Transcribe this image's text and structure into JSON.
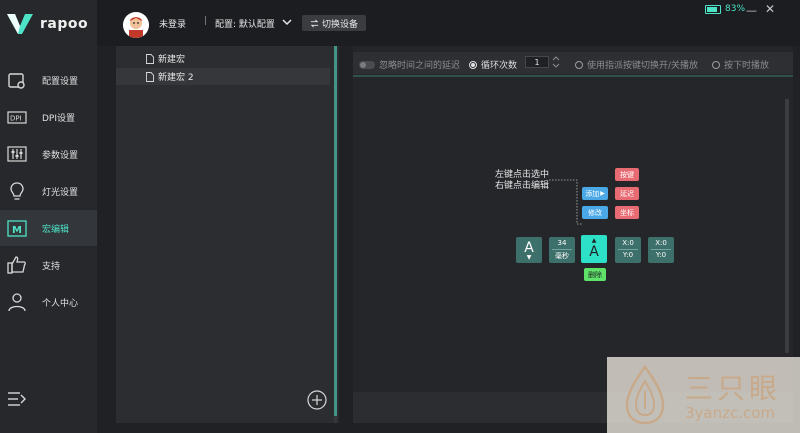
{
  "app": {
    "brand": "rapoo",
    "accent_color": "#4de3c6"
  },
  "sidebar": {
    "items": [
      {
        "label": "配置设置",
        "icon": "mouse-config-icon"
      },
      {
        "label": "DPI设置",
        "icon": "dpi-icon"
      },
      {
        "label": "参数设置",
        "icon": "sliders-icon"
      },
      {
        "label": "灯光设置",
        "icon": "lightbulb-icon"
      },
      {
        "label": "宏编辑",
        "icon": "macro-icon",
        "active": true
      },
      {
        "label": "支持",
        "icon": "thumbs-up-icon"
      },
      {
        "label": "个人中心",
        "icon": "user-icon"
      }
    ],
    "bottom_icon": "collapse-menu-icon"
  },
  "header": {
    "login_status": "未登录",
    "separator": "|",
    "config_label": "配置: 默认配置",
    "switch_device_label": "切换设备",
    "battery_percent": "83%",
    "battery_level": 0.83,
    "minimize_glyph": "—",
    "close_glyph": "✕"
  },
  "macro_list": {
    "items": [
      {
        "label": "新建宏"
      },
      {
        "label": "新建宏 2",
        "selected": true
      }
    ]
  },
  "editor": {
    "options": {
      "ignore_delay_label": "忽略时间之间的延迟",
      "loop_count_label": "循环次数",
      "loop_count_value": "1",
      "toggle_play_label": "使用指派按键切换开/关播放",
      "hold_play_label": "按下时播放"
    },
    "illustration": {
      "hint_line1": "左键点击选中",
      "hint_line2": "右键点击编辑",
      "add_label": "添加",
      "modify_label": "修改",
      "key_label": "按键",
      "delay_label": "延迟",
      "coord_label": "坐标",
      "key_down_char": "A",
      "delay_value": "34",
      "delay_unit": "毫秒",
      "key_up_char": "A",
      "delete_label": "删除",
      "coord1_x": "X:0",
      "coord1_y": "Y:0",
      "coord2_x": "X:0",
      "coord2_y": "Y:0"
    }
  },
  "watermark": {
    "cn_text": "三只眼",
    "en_text": "3yanzc.com"
  }
}
